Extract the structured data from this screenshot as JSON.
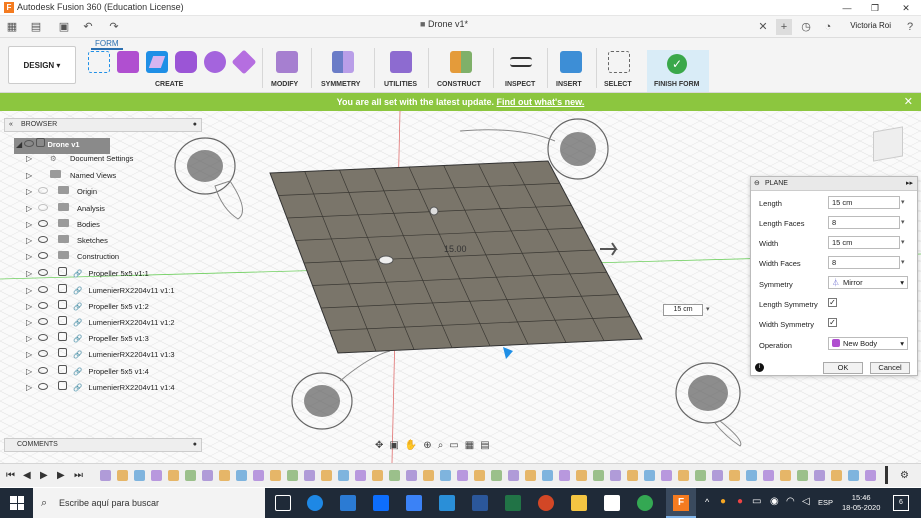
{
  "window": {
    "logo": "F",
    "title": "Autodesk Fusion 360 (Education License)"
  },
  "doc": {
    "tab_title": "Drone v1*",
    "user": "Victoria Roi"
  },
  "ribbon": {
    "mode": "DESIGN",
    "active_tab": "FORM",
    "groups": [
      "CREATE",
      "MODIFY",
      "SYMMETRY",
      "UTILITIES",
      "CONSTRUCT",
      "INSPECT",
      "INSERT",
      "SELECT",
      "FINISH FORM"
    ]
  },
  "banner": {
    "text": "You are all set with the latest update.",
    "link": "Find out what's new."
  },
  "browser": {
    "title": "BROWSER",
    "root": "Drone v1",
    "items": [
      "Document Settings",
      "Named Views",
      "Origin",
      "Analysis",
      "Bodies",
      "Sketches",
      "Construction",
      "Propeller 5x5 v1:1",
      "LumenierRX2204v11 v1:1",
      "Propeller 5x5 v1:2",
      "LumenierRX2204v11 v1:2",
      "Propeller 5x5 v1:3",
      "LumenierRX2204v11 v1:3",
      "Propeller 5x5 v1:4",
      "LumenierRX2204v11 v1:4"
    ]
  },
  "comments": {
    "title": "COMMENTS"
  },
  "viewport": {
    "plane_label": "15.00",
    "dimension": "15 cm"
  },
  "plane_panel": {
    "title": "PLANE",
    "length_label": "Length",
    "length": "15 cm",
    "length_faces_label": "Length Faces",
    "length_faces": "8",
    "width_label": "Width",
    "width": "15 cm",
    "width_faces_label": "Width Faces",
    "width_faces": "8",
    "symmetry_label": "Symmetry",
    "symmetry": "Mirror",
    "length_sym_label": "Length Symmetry",
    "width_sym_label": "Width Symmetry",
    "operation_label": "Operation",
    "operation": "New Body",
    "ok": "OK",
    "cancel": "Cancel"
  },
  "taskbar": {
    "search_placeholder": "Escribe aquí para buscar",
    "lang": "ESP",
    "time": "15:46",
    "date": "18-05-2020",
    "notifications": "6"
  },
  "colors": {
    "accent": "#1f8fe6",
    "banner": "#8cc63f",
    "plane_fill": "#7a756a",
    "taskbar": "#1f2a38"
  }
}
